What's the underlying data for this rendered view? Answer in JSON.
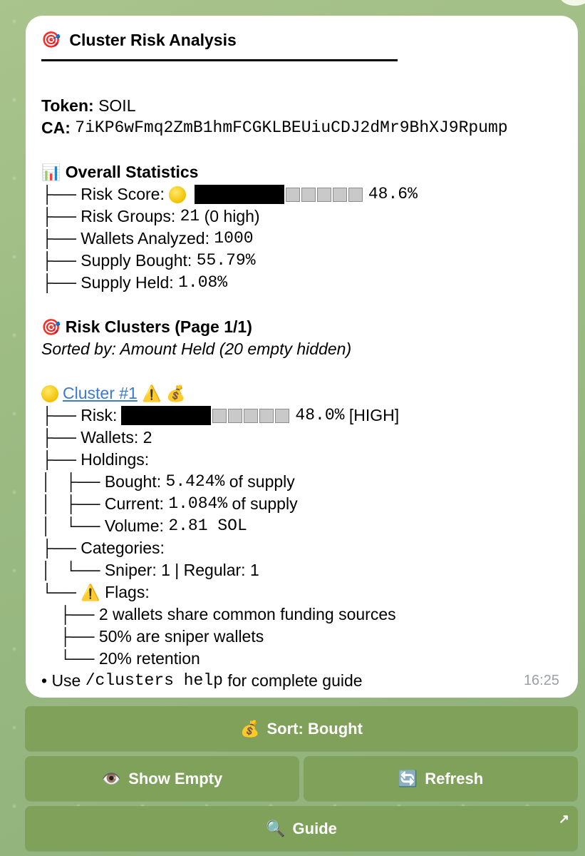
{
  "title": "Cluster Risk Analysis",
  "token": {
    "label": "Token:",
    "value": "SOIL"
  },
  "ca": {
    "label": "CA:",
    "value": "7iKP6wFmq2ZmB1hmFCGKLBEUiuCDJ2dMr9BhXJ9Rpump"
  },
  "overall": {
    "heading": "Overall Statistics",
    "risk_score_label": "Risk Score:",
    "risk_score_value": "48.6%",
    "risk_groups_label": "Risk Groups:",
    "risk_groups_value": "21",
    "risk_groups_suffix": "(0 high)",
    "wallets_label": "Wallets Analyzed:",
    "wallets_value": "1000",
    "bought_label": "Supply Bought:",
    "bought_value": "55.79%",
    "held_label": "Supply Held:",
    "held_value": "1.08%"
  },
  "clusters": {
    "heading": "Risk Clusters (Page 1/1)",
    "sorted_by": "Sorted by: Amount Held (20 empty hidden)"
  },
  "cluster1": {
    "name": "Cluster #1",
    "risk_label": "Risk:",
    "risk_value": "48.0%",
    "risk_level": "[HIGH]",
    "wallets_label": "Wallets:",
    "wallets_value": "2",
    "holdings_label": "Holdings:",
    "bought_label": "Bought:",
    "bought_value": "5.424%",
    "bought_suffix": "of supply",
    "current_label": "Current:",
    "current_value": "1.084%",
    "current_suffix": "of supply",
    "volume_label": "Volume:",
    "volume_value": "2.81 SOL",
    "categories_label": "Categories:",
    "categories_value": "Sniper: 1 | Regular: 1",
    "flags_label": "Flags:",
    "flags": [
      "2 wallets share common funding sources",
      "50% are sniper wallets",
      "20% retention"
    ]
  },
  "footer": {
    "prefix": "• Use",
    "command": "/clusters help",
    "suffix": "for complete guide",
    "time": "16:25"
  },
  "buttons": {
    "sort": "Sort: Bought",
    "show_empty": "Show Empty",
    "refresh": "Refresh",
    "guide": "Guide"
  },
  "icons": {
    "title": "target-icon",
    "stats": "bar-chart-icon",
    "risk_dot": "yellow-circle-icon",
    "warning": "warning-icon",
    "money_bag": "money-bag-icon",
    "eye": "eye-icon",
    "refresh": "refresh-icon",
    "search": "magnifier-icon",
    "external": "arrow-up-right-icon"
  },
  "colors": {
    "button_bg": "#7fa15a",
    "link": "#3a7ad1",
    "bubble_bg": "#ffffff"
  }
}
